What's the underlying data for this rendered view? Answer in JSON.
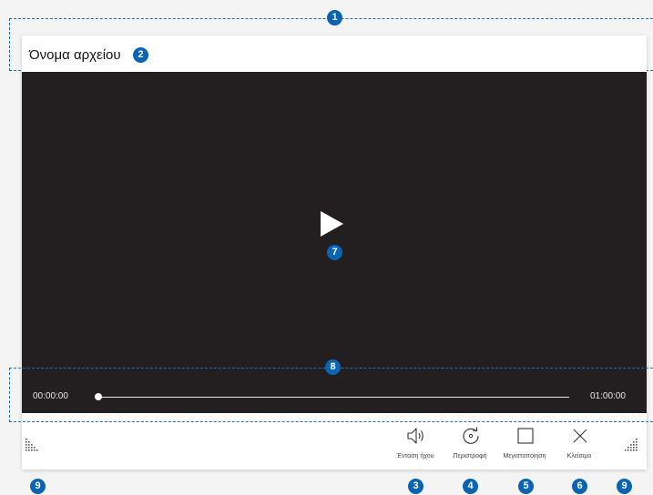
{
  "window": {
    "title": "Όνομα αρχείου"
  },
  "video": {
    "time_current": "00:00:00",
    "time_total": "01:00:00",
    "progress_fraction": 0.0
  },
  "controls": [
    {
      "key": "volume",
      "label": "Ένταση ήχου",
      "icon": "volume-icon"
    },
    {
      "key": "rotate",
      "label": "Περιστροφή",
      "icon": "rotate-icon"
    },
    {
      "key": "maximize",
      "label": "Μεγιστοποίηση",
      "icon": "maximize-icon"
    },
    {
      "key": "close",
      "label": "Κλείσιμο",
      "icon": "close-icon"
    }
  ],
  "callouts": {
    "title_region": "1",
    "file_name": "2",
    "volume": "3",
    "rotate": "4",
    "maximize": "5",
    "close": "6",
    "play": "7",
    "seek_region": "8",
    "resize_left": "9",
    "resize_right": "9"
  },
  "colors": {
    "video_background": "#231f20",
    "callout": "#0a64b4",
    "callout_line": "#1a6fc0"
  }
}
